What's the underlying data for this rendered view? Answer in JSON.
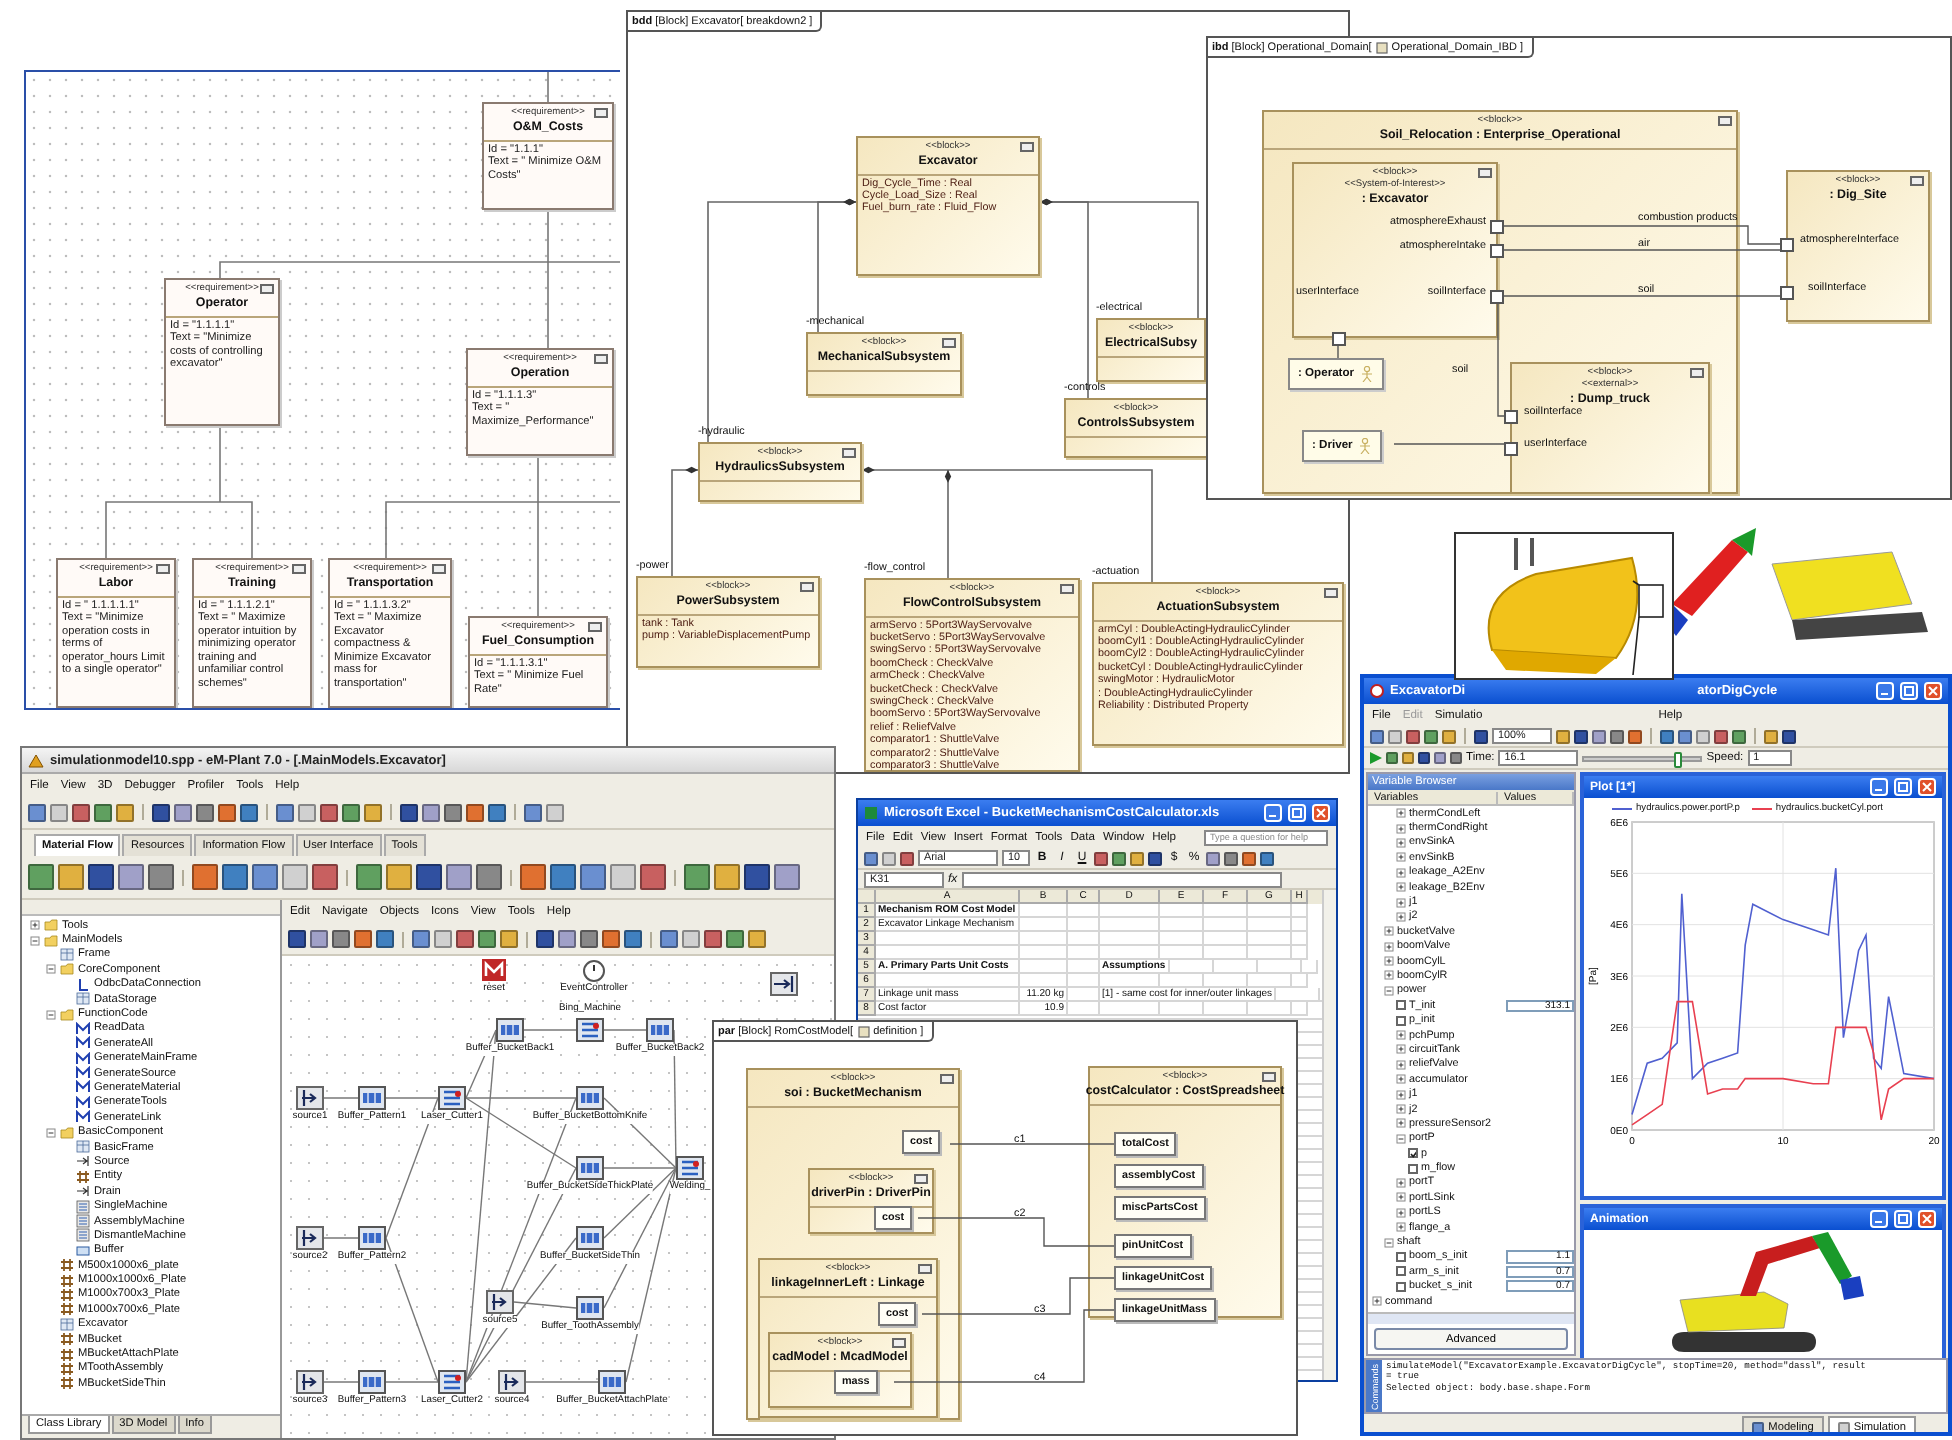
{
  "requirements_diagram": {
    "requirements": [
      {
        "stereotype": "<<requirement>>",
        "name": "O&M_Costs",
        "id": "Id = \"1.1.1\"",
        "text": "Text = \" Minimize O&M Costs\""
      },
      {
        "stereotype": "<<requirement>>",
        "name": "Operator",
        "id": "Id = \"1.1.1.1\"",
        "text": "Text = \"Minimize costs of controlling excavator\""
      },
      {
        "stereotype": "<<requirement>>",
        "name": "Operation",
        "id": "Id = \"1.1.1.3\"",
        "text": "Text = \" Maximize_Performance\""
      },
      {
        "stereotype": "<<requirement>>",
        "name": "Labor",
        "id": "Id = \" 1.1.1.1.1\"",
        "text": "Text = \"Minimize operation costs in terms of operator_hours Limit to a single operator\""
      },
      {
        "stereotype": "<<requirement>>",
        "name": "Training",
        "id": "Id = \" 1.1.1.2.1\"",
        "text": "Text = \" Maximize operator intuition by minimizing operator training and unfamiliar control schemes\""
      },
      {
        "stereotype": "<<requirement>>",
        "name": "Transportation",
        "id": "Id = \" 1.1.1.3.2\"",
        "text": "Text = \" Maximize Excavator compactness & Minimize Excavator mass for transportation\""
      },
      {
        "stereotype": "<<requirement>>",
        "name": "Fuel_Consumption",
        "id": "Id = \"1.1.1.3.1\"",
        "text": "Text = \" Minimize Fuel Rate\""
      }
    ]
  },
  "bdd": {
    "frame_title": "**bdd** [Block] Excavator[ breakdown2 ]",
    "blocks": [
      {
        "stereotype": "<<block>>",
        "name": "Excavator",
        "attributes": [
          "Dig_Cycle_Time : Real",
          "Cycle_Load_Size : Real",
          "Fuel_burn_rate : Fluid_Flow"
        ]
      },
      {
        "role": "-mechanical",
        "stereotype": "<<block>>",
        "name": "MechanicalSubsystem"
      },
      {
        "role": "-electrical",
        "stereotype": "<<block>>",
        "name": "ElectricalSubsy"
      },
      {
        "role": "-controls",
        "stereotype": "<<block>>",
        "name": "ControlsSubsystem"
      },
      {
        "role": "-hydraulic",
        "stereotype": "<<block>>",
        "name": "HydraulicsSubsystem"
      },
      {
        "role": "-power",
        "stereotype": "<<block>>",
        "name": "PowerSubsystem",
        "attributes": [
          "tank : Tank",
          "pump : VariableDisplacementPump"
        ]
      },
      {
        "role": "-flow_control",
        "stereotype": "<<block>>",
        "name": "FlowControlSubsystem",
        "attributes": [
          "armServo : 5Port3WayServovalve",
          "bucketServo : 5Port3WayServovalve",
          "swingServo : 5Port3WayServovalve",
          "boomCheck : CheckValve",
          "armCheck : CheckValve",
          "bucketCheck : CheckValve",
          "swingCheck : CheckValve",
          "boomServo : 5Port3WayServovalve",
          "relief : ReliefValve",
          "comparator1 : ShuttleValve",
          "comparator2 : ShuttleValve",
          "comparator3 : ShuttleValve"
        ]
      },
      {
        "role": "-actuation",
        "stereotype": "<<block>>",
        "name": "ActuationSubsystem",
        "attributes": [
          "armCyl : DoubleActingHydraulicCylinder",
          "boomCyl1 : DoubleActingHydraulicCylinder",
          "boomCyl2 : DoubleActingHydraulicCylinder",
          "bucketCyl : DoubleActingHydraulicCylinder",
          "swingMotor : HydraulicMotor",
          ": DoubleActingHydraulicCylinder",
          "Reliability : Distributed Property"
        ]
      }
    ]
  },
  "ibd": {
    "frame_title": "**ibd** [Block] Operational_Domain[",
    "diagram_name": "Operational_Domain_IBD ]",
    "context": {
      "stereotype": "<<block>>",
      "name": "Soil_Relocation : Enterprise_Operational"
    },
    "parts": [
      {
        "kind": "block",
        "stereotypes": [
          "<<block>>",
          "<<System-of-Interest>>"
        ],
        "name": ": Excavator",
        "ports": [
          "atmosphereExhaust",
          "atmosphereIntake",
          "userInterface",
          "soilInterface"
        ]
      },
      {
        "kind": "block",
        "stereotypes": [
          "<<block>>"
        ],
        "name": ": Dig_Site",
        "ports": [
          "atmosphereInterface",
          "soilInterface"
        ]
      },
      {
        "kind": "actor",
        "name": ": Operator"
      },
      {
        "kind": "actor",
        "name": ": Driver"
      },
      {
        "kind": "block",
        "stereotypes": [
          "<<block>>",
          "<<external>>"
        ],
        "name": ": Dump_truck",
        "ports": [
          "soilInterface",
          "userInterface"
        ]
      }
    ],
    "connectors": [
      "combustion products",
      "air",
      "soil",
      "soil"
    ]
  },
  "em_plant": {
    "title": "simulationmodel10.spp - eM-Plant 7.0 - [.MainModels.Excavator]",
    "menu": [
      "File",
      "View",
      "3D",
      "Debugger",
      "Profiler",
      "Tools",
      "Help"
    ],
    "tabs": [
      {
        "label": "Material Flow",
        "selected": true
      },
      {
        "label": "Resources",
        "selected": false
      },
      {
        "label": "Information Flow",
        "selected": false
      },
      {
        "label": "User Interface",
        "selected": false
      },
      {
        "label": "Tools",
        "selected": false
      }
    ],
    "tree": [
      {
        "label": "Tools",
        "kind": "folder",
        "expanded": false
      },
      {
        "label": "MainModels",
        "kind": "folder",
        "expanded": true,
        "children": [
          {
            "label": "Frame",
            "kind": "frame"
          },
          {
            "label": "CoreComponent",
            "kind": "folder",
            "expanded": true,
            "children": [
              {
                "label": "OdbcDataConnection",
                "kind": "connection"
              },
              {
                "label": "DataStorage",
                "kind": "frame"
              }
            ]
          },
          {
            "label": "FunctionCode",
            "kind": "folder",
            "expanded": true,
            "children": [
              {
                "label": "ReadData",
                "kind": "method"
              },
              {
                "label": "GenerateAll",
                "kind": "method"
              },
              {
                "label": "GenerateMainFrame",
                "kind": "method"
              },
              {
                "label": "GenerateSource",
                "kind": "method"
              },
              {
                "label": "GenerateMaterial",
                "kind": "method"
              },
              {
                "label": "GenerateTools",
                "kind": "method"
              },
              {
                "label": "GenerateLink",
                "kind": "method"
              }
            ]
          },
          {
            "label": "BasicComponent",
            "kind": "folder",
            "expanded": true,
            "children": [
              {
                "label": "BasicFrame",
                "kind": "frame"
              },
              {
                "label": "Source",
                "kind": "source"
              },
              {
                "label": "Entity",
                "kind": "entity"
              },
              {
                "label": "Drain",
                "kind": "drain"
              },
              {
                "label": "SingleMachine",
                "kind": "machine"
              },
              {
                "label": "AssemblyMachine",
                "kind": "machine"
              },
              {
                "label": "DismantleMachine",
                "kind": "machine"
              },
              {
                "label": "Buffer",
                "kind": "buffer"
              }
            ]
          },
          {
            "label": "M500x1000x6_plate",
            "kind": "entity"
          },
          {
            "label": "M1000x1000x6_Plate",
            "kind": "entity"
          },
          {
            "label": "M1000x700x3_Plate",
            "kind": "entity"
          },
          {
            "label": "M1000x700x6_Plate",
            "kind": "entity"
          },
          {
            "label": "Excavator",
            "kind": "frame"
          },
          {
            "label": "MBucket",
            "kind": "entity"
          },
          {
            "label": "MBucketAttachPlate",
            "kind": "entity"
          },
          {
            "label": "MToothAssembly",
            "kind": "entity"
          },
          {
            "label": "MBucketSideThin",
            "kind": "entity"
          }
        ]
      }
    ],
    "bottom_tabs": [
      {
        "label": "Class Library",
        "selected": true
      },
      {
        "label": "3D Model",
        "selected": false
      },
      {
        "label": "Info",
        "selected": false
      }
    ],
    "editor_menu": [
      "Edit",
      "Navigate",
      "Objects",
      "Icons",
      "View",
      "Tools",
      "Help"
    ],
    "nodes": [
      {
        "kind": "method",
        "label": "reset"
      },
      {
        "kind": "event",
        "label": "EventController"
      },
      {
        "kind": "buffer",
        "label": "Buffer_BucketBack1"
      },
      {
        "kind": "machine",
        "label": "Bing_Machine"
      },
      {
        "kind": "buffer",
        "label": "Buffer_BucketBack2"
      },
      {
        "kind": "source",
        "label": "source1"
      },
      {
        "kind": "buffer",
        "label": "Buffer_Pattern1"
      },
      {
        "kind": "machine",
        "label": "Laser_Cutter1"
      },
      {
        "kind": "buffer",
        "label": "Buffer_BucketBottomKnife"
      },
      {
        "kind": "buffer",
        "label": "Buffer_BucketSideThickPlate"
      },
      {
        "kind": "machine",
        "label": "Welding_"
      },
      {
        "kind": "source",
        "label": "source2"
      },
      {
        "kind": "buffer",
        "label": "Buffer_Pattern2"
      },
      {
        "kind": "buffer",
        "label": "Buffer_BucketSideThin"
      },
      {
        "kind": "source",
        "label": "source5"
      },
      {
        "kind": "buffer",
        "label": "Buffer_ToothAssembly"
      },
      {
        "kind": "source",
        "label": "source3"
      },
      {
        "kind": "buffer",
        "label": "Buffer_Pattern3"
      },
      {
        "kind": "machine",
        "label": "Laser_Cutter2"
      },
      {
        "kind": "source",
        "label": "source4"
      },
      {
        "kind": "buffer",
        "label": "Buffer_BucketAttachPlate"
      },
      {
        "kind": "drain"
      }
    ]
  },
  "excel": {
    "title": "Microsoft Excel - BucketMechanismCostCalculator.xls",
    "menu": [
      "File",
      "Edit",
      "View",
      "Insert",
      "Format",
      "Tools",
      "Data",
      "Window",
      "Help"
    ],
    "help_placeholder": "Type a question for help",
    "font": "Arial",
    "font_size": "10",
    "format_buttons": [
      "B",
      "I",
      "U"
    ],
    "number_buttons": [
      "$",
      "%"
    ],
    "name_box": "K31",
    "fx": "fx",
    "columns": [
      "A",
      "B",
      "C",
      "D",
      "E",
      "F",
      "G",
      "H"
    ],
    "rows": [
      {
        "number": "1",
        "bold": true,
        "a": "Mechanism ROM Cost Model"
      },
      {
        "number": "2",
        "bold": false,
        "a": "Excavator Linkage Mechanism"
      },
      {
        "number": "3"
      },
      {
        "number": "4"
      },
      {
        "number": "5",
        "bold": true,
        "a": "A. Primary Parts Unit Costs",
        "d": "Assumptions"
      },
      {
        "number": "6"
      },
      {
        "number": "7",
        "bold": false,
        "a": "Linkage unit mass",
        "b": "11.20 kg",
        "d": "[1] - same cost for inner/outer linkages"
      },
      {
        "number": "8",
        "bold": false,
        "a": "Cost factor",
        "b": "10.9"
      }
    ]
  },
  "par": {
    "frame_title": "**par** [Block] RomCostModel[",
    "diagram_name": "definition ]",
    "blocks": [
      {
        "stereotype": "<<block>>",
        "name": "soi : BucketMechanism",
        "ports": [
          "cost"
        ]
      },
      {
        "stereotype": "<<block>>",
        "name": "driverPin : DriverPin",
        "ports": [
          "cost"
        ]
      },
      {
        "stereotype": "<<block>>",
        "name": "linkageInnerLeft : Linkage",
        "ports": [
          "cost"
        ]
      },
      {
        "stereotype": "<<block>>",
        "name": "cadModel : McadModel",
        "ports": [
          "mass"
        ]
      },
      {
        "stereotype": "<<block>>",
        "name": "costCalculator : CostSpreadsheet",
        "ports": [
          "totalCost",
          "assemblyCost",
          "miscPartsCost",
          "pinUnitCost",
          "linkageUnitCost",
          "linkageUnitMass"
        ]
      }
    ],
    "connectors": [
      "c1",
      "c2",
      "c3",
      "c4"
    ]
  },
  "dymola": {
    "title_parts": [
      "ExcavatorDi",
      "atorDigCycle"
    ],
    "menu": [
      {
        "label": "File",
        "disabled": false
      },
      {
        "label": "Edit",
        "disabled": true
      },
      {
        "label": "Simulatio",
        "disabled": false
      },
      {
        "label": "Help",
        "disabled": false
      }
    ],
    "zoom": "100%",
    "time_label": "Time:",
    "time": "16.1",
    "time_slider": {
      "level": 0.8
    },
    "speed_label": "Speed:",
    "speed": "1",
    "browser_title": "Variable Browser",
    "browser_columns": [
      "Variables",
      "Values"
    ],
    "variables": [
      {
        "kind": "group",
        "children": [
          {
            "kind": "group",
            "children": [
              {
                "kind": "component",
                "label": "thermCondLeft",
                "expanded": false
              },
              {
                "kind": "component",
                "label": "thermCondRight",
                "expanded": false
              },
              {
                "kind": "component",
                "label": "envSinkA",
                "expanded": false
              },
              {
                "kind": "component",
                "label": "envSinkB",
                "expanded": false
              },
              {
                "kind": "component",
                "label": "leakage_A2Env",
                "expanded": false
              },
              {
                "kind": "component",
                "label": "leakage_B2Env",
                "expanded": false
              },
              {
                "kind": "component",
                "label": "j1",
                "expanded": false
              },
              {
                "kind": "component",
                "label": "j2",
                "expanded": false
              }
            ]
          },
          {
            "kind": "component",
            "label": "bucketValve",
            "expanded": false
          },
          {
            "kind": "component",
            "label": "boomValve",
            "expanded": false
          },
          {
            "kind": "component",
            "label": "boomCylL",
            "expanded": false
          },
          {
            "kind": "component",
            "label": "boomCylR",
            "expanded": false
          },
          {
            "kind": "component",
            "label": "power",
            "expanded": true,
            "children": [
              {
                "kind": "parameter",
                "label": "T_init",
                "checked": false,
                "value": "313.1"
              },
              {
                "kind": "parameter",
                "label": "p_init",
                "checked": false
              },
              {
                "kind": "component",
                "label": "pchPump",
                "expanded": false
              },
              {
                "kind": "component",
                "label": "circuitTank",
                "expanded": false
              },
              {
                "kind": "component",
                "label": "reliefValve",
                "expanded": false
              },
              {
                "kind": "component",
                "label": "accumulator",
                "expanded": false
              },
              {
                "kind": "component",
                "label": "j1",
                "expanded": false
              },
              {
                "kind": "component",
                "label": "j2",
                "expanded": false
              },
              {
                "kind": "component",
                "label": "pressureSensor2",
                "expanded": false
              },
              {
                "kind": "component",
                "label": "portP",
                "expanded": true,
                "children": [
                  {
                    "kind": "parameter",
                    "label": "p",
                    "checked": true
                  },
                  {
                    "kind": "parameter",
                    "label": "m_flow",
                    "checked": false
                  }
                ]
              },
              {
                "kind": "component",
                "label": "portT",
                "expanded": false
              },
              {
                "kind": "component",
                "label": "portLSink",
                "expanded": false
              },
              {
                "kind": "component",
                "label": "portLS",
                "expanded": false
              },
              {
                "kind": "component",
                "label": "flange_a",
                "expanded": false
              }
            ]
          },
          {
            "kind": "component",
            "label": "shaft",
            "expanded": true,
            "children": [
              {
                "kind": "parameter",
                "label": "boom_s_init",
                "checked": false,
                "value": "1.1"
              },
              {
                "kind": "parameter",
                "label": "arm_s_init",
                "checked": false,
                "value": "0.7"
              },
              {
                "kind": "parameter",
                "label": "bucket_s_init",
                "checked": false,
                "value": "0.7"
              }
            ]
          }
        ]
      },
      {
        "kind": "component",
        "label": "command",
        "expanded": false
      }
    ],
    "advanced_button": "Advanced",
    "plot": {
      "title": "Plot [1*]",
      "chart_data": {
        "type": "line",
        "ylabel": "[Pa]",
        "x": [
          0,
          1,
          2,
          3,
          3.3,
          4,
          5,
          6,
          7,
          7.5,
          8,
          10,
          12,
          13,
          13.5,
          14,
          15,
          15.5,
          16,
          16.5,
          17,
          18,
          20
        ],
        "series": [
          {
            "name": "hydraulics.power.portP.p",
            "color": "#5060d0",
            "values": [
              300000,
              1300000,
              1400000,
              1700000,
              4600000,
              1000000,
              1300000,
              1400000,
              1500000,
              3600000,
              4400000,
              4100000,
              3900000,
              3800000,
              5100000,
              1800000,
              3500000,
              3800000,
              1400000,
              1200000,
              2600000,
              1100000,
              1000000
            ]
          },
          {
            "name": "hydraulics.bucketCyl.port",
            "color": "#e84050",
            "values": [
              100000,
              300000,
              500000,
              2500000,
              2500000,
              2500000,
              700000,
              800000,
              800000,
              1000000,
              1000000,
              1000000,
              900000,
              900000,
              2000000,
              2000000,
              2000000,
              2000000,
              1500000,
              200000,
              800000,
              1000000,
              1000000
            ]
          }
        ],
        "grid": true,
        "xlim": [
          0,
          20
        ],
        "ylim": [
          0,
          6000000
        ],
        "xticks": [
          0,
          10,
          20
        ],
        "yticks": [
          {
            "value": 0,
            "label": "0E0"
          },
          {
            "value": 1000000,
            "label": "1E6"
          },
          {
            "value": 2000000,
            "label": "2E6"
          },
          {
            "value": 3000000,
            "label": "3E6"
          },
          {
            "value": 4000000,
            "label": "4E6"
          },
          {
            "value": 5000000,
            "label": "5E6"
          },
          {
            "value": 6000000,
            "label": "6E6"
          }
        ]
      }
    },
    "animation": {
      "title": "Animation"
    },
    "command_side_label": "Commands",
    "commands": [
      "simulateModel(\"ExcavatorExample.ExcavatorDigCycle\", stopTime=20, method=\"dassl\", result",
      "= true",
      "Selected object: body.base.shape.Form"
    ],
    "modes": [
      {
        "label": "Modeling",
        "selected": false
      },
      {
        "label": "Simulation",
        "selected": true
      }
    ]
  }
}
